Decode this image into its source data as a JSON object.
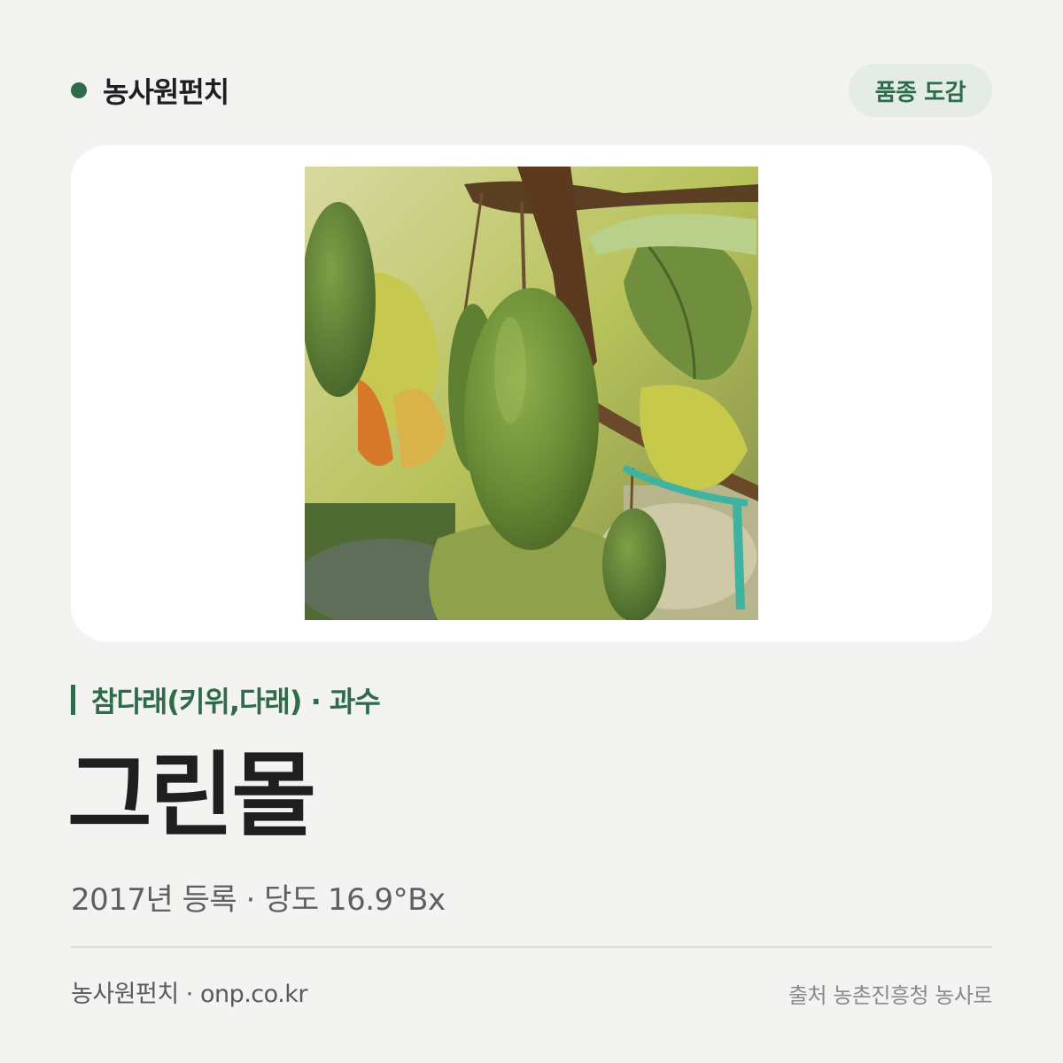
{
  "header": {
    "brand_name": "농사원펀치",
    "badge_label": "품종 도감",
    "brand_color": "#2e6b4a"
  },
  "card": {
    "image_icon": "kiwi-fruit-photo"
  },
  "variety": {
    "category": "참다래(키위,다래) · 과수",
    "name": "그린몰",
    "meta": "2017년 등록 · 당도 16.9°Bx"
  },
  "footer": {
    "site": "농사원펀치 · onp.co.kr",
    "source": "출처 농촌진흥청 농사로"
  }
}
